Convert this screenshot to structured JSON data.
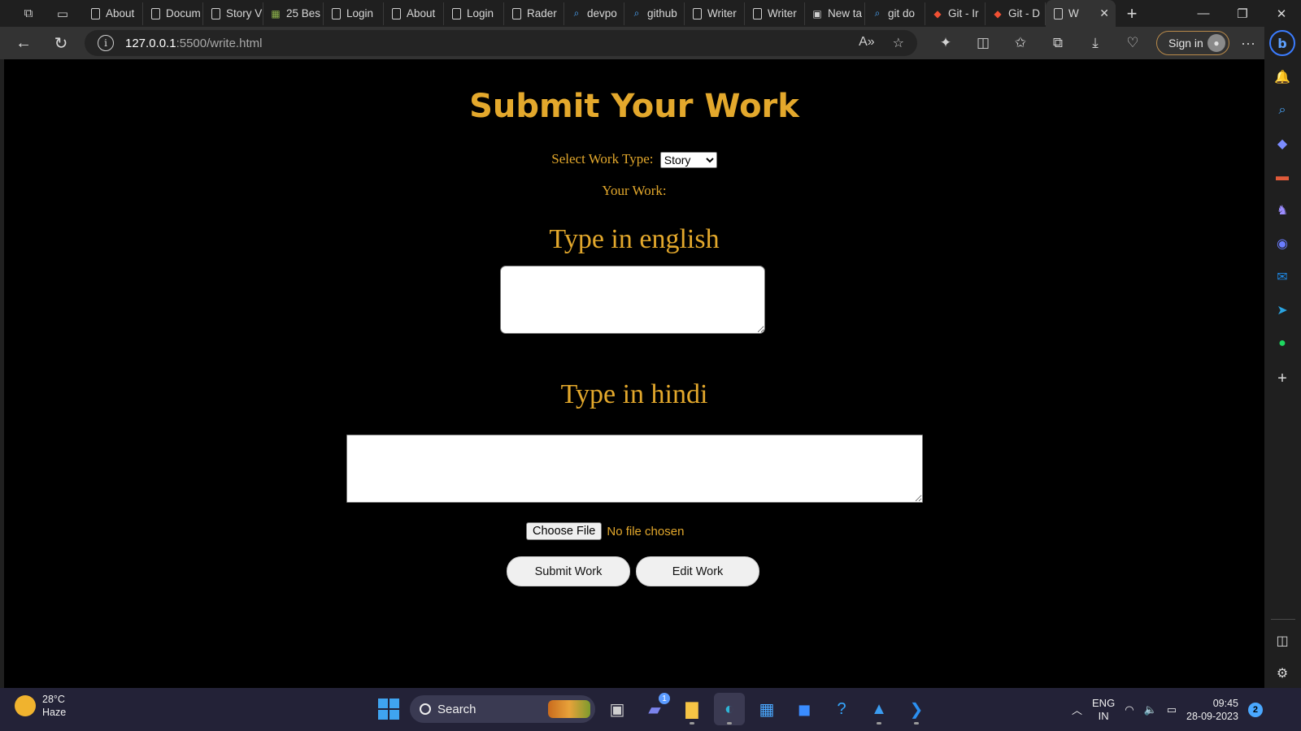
{
  "browser": {
    "tabs": [
      {
        "label": "About",
        "icon": "doc"
      },
      {
        "label": "Docum",
        "icon": "doc"
      },
      {
        "label": "Story V",
        "icon": "doc"
      },
      {
        "label": "25 Bes",
        "icon": "image"
      },
      {
        "label": "Login",
        "icon": "doc"
      },
      {
        "label": "About",
        "icon": "doc"
      },
      {
        "label": "Login",
        "icon": "doc"
      },
      {
        "label": "Rader",
        "icon": "doc"
      },
      {
        "label": "devpo",
        "icon": "search"
      },
      {
        "label": "github",
        "icon": "search"
      },
      {
        "label": "Writer",
        "icon": "doc"
      },
      {
        "label": "Writer",
        "icon": "doc"
      },
      {
        "label": "New ta",
        "icon": "newtab"
      },
      {
        "label": "git do",
        "icon": "search"
      },
      {
        "label": "Git - Ir",
        "icon": "git"
      },
      {
        "label": "Git - D",
        "icon": "git"
      }
    ],
    "active_tab": {
      "label": "W",
      "icon": "doc"
    },
    "url_host": "127.0.0.1",
    "url_rest": ":5500/write.html",
    "signin_label": "Sign in"
  },
  "page": {
    "title": "Submit Your Work",
    "work_type_label": "Select Work Type:",
    "work_type_value": "Story",
    "your_work_label": "Your Work:",
    "english_heading": "Type in english",
    "hindi_heading": "Type in hindi",
    "choose_file_label": "Choose File",
    "no_file_label": "No file chosen",
    "submit_label": "Submit Work",
    "edit_label": "Edit Work"
  },
  "taskbar": {
    "temperature": "28°C",
    "weather": "Haze",
    "search_label": "Search",
    "lang_top": "ENG",
    "lang_bottom": "IN",
    "time": "09:45",
    "date": "28-09-2023",
    "notification_count": "2",
    "teams_badge": "1"
  },
  "colors": {
    "accent": "#e3a82c",
    "page_bg": "#000000"
  }
}
